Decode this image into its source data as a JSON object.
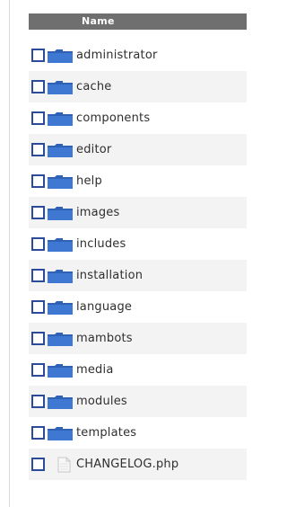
{
  "table": {
    "header": {
      "name_label": "Name"
    },
    "rows": [
      {
        "type": "folder",
        "name": "administrator",
        "icon": "folder-icon"
      },
      {
        "type": "folder",
        "name": "cache",
        "icon": "folder-icon"
      },
      {
        "type": "folder",
        "name": "components",
        "icon": "folder-icon"
      },
      {
        "type": "folder",
        "name": "editor",
        "icon": "folder-icon"
      },
      {
        "type": "folder",
        "name": "help",
        "icon": "folder-icon"
      },
      {
        "type": "folder",
        "name": "images",
        "icon": "folder-icon"
      },
      {
        "type": "folder",
        "name": "includes",
        "icon": "folder-icon"
      },
      {
        "type": "folder",
        "name": "installation",
        "icon": "folder-icon"
      },
      {
        "type": "folder",
        "name": "language",
        "icon": "folder-icon"
      },
      {
        "type": "folder",
        "name": "mambots",
        "icon": "folder-icon"
      },
      {
        "type": "folder",
        "name": "media",
        "icon": "folder-icon"
      },
      {
        "type": "folder",
        "name": "modules",
        "icon": "folder-icon"
      },
      {
        "type": "folder",
        "name": "templates",
        "icon": "folder-icon"
      },
      {
        "type": "file",
        "name": "CHANGELOG.php",
        "icon": "file-icon"
      }
    ]
  },
  "colors": {
    "header_bg": "#6f6f6f",
    "header_text": "#ffffff",
    "checkbox_border": "#2c4c9a",
    "folder_blue": "#2f61b5",
    "row_alt": "#f3f3f3"
  }
}
